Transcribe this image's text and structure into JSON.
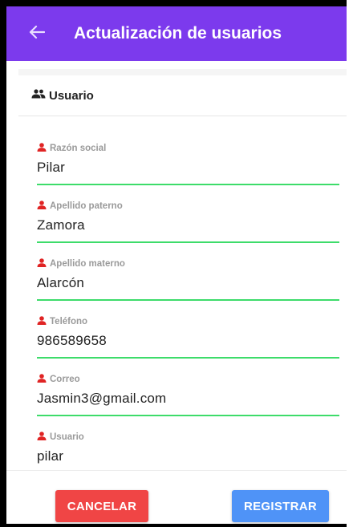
{
  "appbar": {
    "title": "Actualización de usuarios",
    "back_icon": "arrow-left-icon",
    "color": "#7c3aed"
  },
  "section": {
    "icon": "people-icon",
    "label": "Usuario"
  },
  "fields": [
    {
      "label": "Razón social",
      "value": "Pilar"
    },
    {
      "label": "Apellido paterno",
      "value": "Zamora"
    },
    {
      "label": "Apellido materno",
      "value": "Alarcón"
    },
    {
      "label": "Teléfono",
      "value": "986589658"
    },
    {
      "label": "Correo",
      "value": "Jasmin3@gmail.com"
    },
    {
      "label": "Usuario",
      "value": "pilar"
    }
  ],
  "field_icon": "person-icon",
  "colors": {
    "field_icon": "#e02424",
    "underline": "#3ddc6a",
    "cancel": "#f04545",
    "register": "#4f93f7"
  },
  "actions": {
    "cancel_label": "CANCELAR",
    "register_label": "REGISTRAR"
  }
}
